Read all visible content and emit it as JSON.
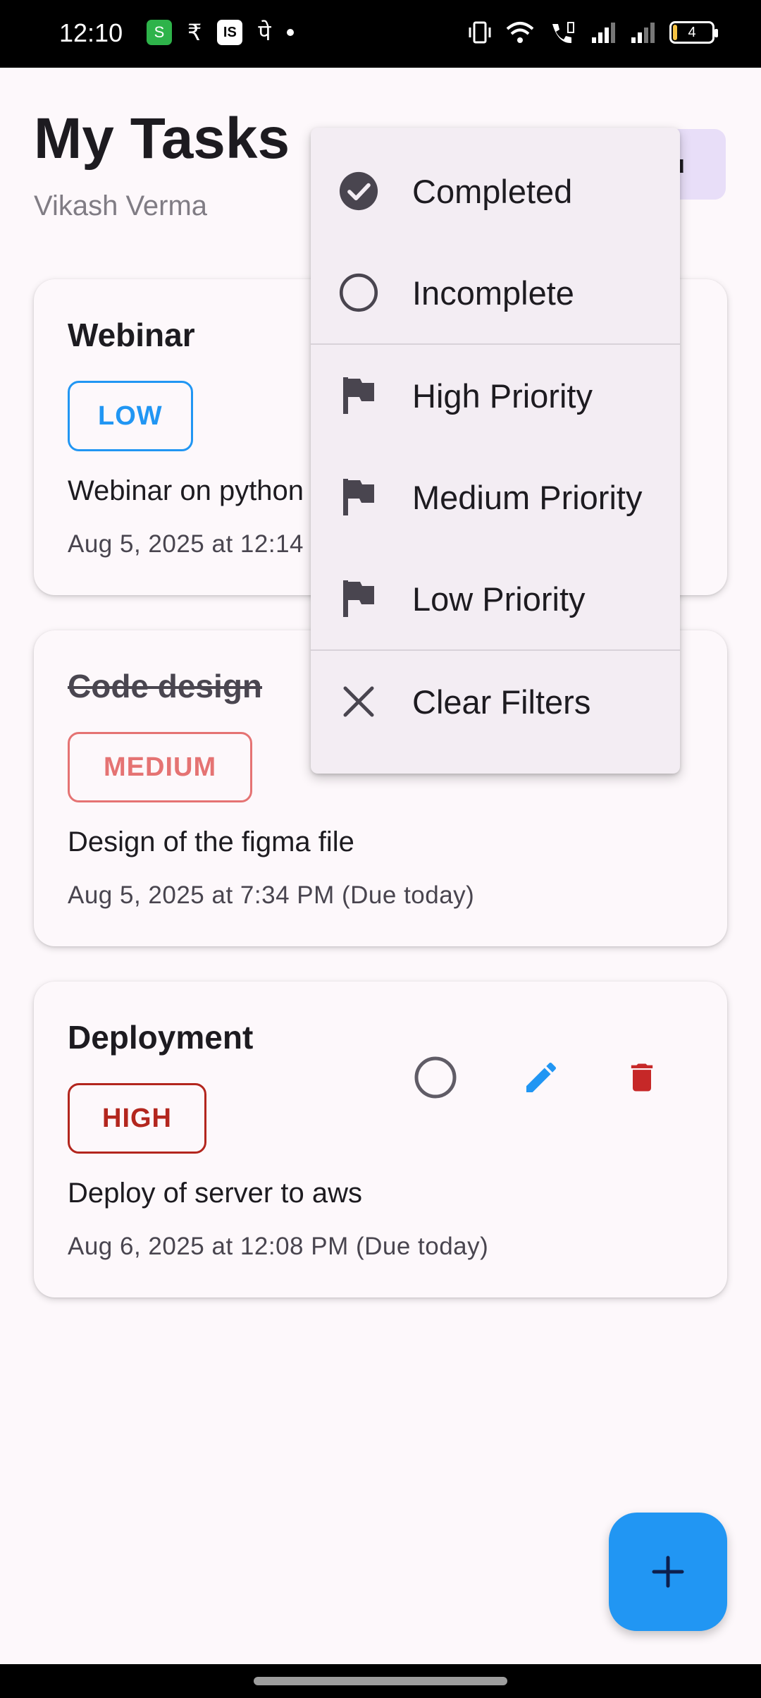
{
  "status_bar": {
    "time": "12:10",
    "app_badge": "S",
    "notif_glyph_1": "₹",
    "notif_glyph_2": "IS",
    "notif_glyph_3": "पे",
    "battery_level": "4"
  },
  "header": {
    "title": "My Tasks",
    "user_name": "Vikash Verma",
    "chip_text": "u"
  },
  "tasks": [
    {
      "title": "Webinar",
      "priority": "LOW",
      "priority_color": "#2196f3",
      "description": "Webinar on python",
      "due": "Aug 5, 2025 at 12:14",
      "completed": false
    },
    {
      "title": "Code design",
      "priority": "MEDIUM",
      "priority_color": "#e57373",
      "description": "Design of the figma file",
      "due": "Aug 5, 2025 at 7:34 PM (Due today)",
      "completed": true
    },
    {
      "title": "Deployment",
      "priority": "HIGH",
      "priority_color": "#b3261e",
      "description": "Deploy of server to aws",
      "due": "Aug 6, 2025 at 12:08 PM (Due today)",
      "completed": false
    }
  ],
  "filter_menu": {
    "items": [
      {
        "label": "Completed",
        "icon": "check-circle-icon"
      },
      {
        "label": "Incomplete",
        "icon": "circle-outline-icon"
      },
      {
        "label": "High Priority",
        "icon": "flag-icon"
      },
      {
        "label": "Medium Priority",
        "icon": "flag-icon"
      },
      {
        "label": "Low Priority",
        "icon": "flag-icon"
      },
      {
        "label": "Clear Filters",
        "icon": "close-icon"
      }
    ]
  },
  "colors": {
    "accent": "#2196f3",
    "edit_icon": "#2196f3",
    "delete_icon": "#c62828",
    "menu_icon": "#49454f"
  },
  "fab": {
    "icon": "plus-icon"
  }
}
